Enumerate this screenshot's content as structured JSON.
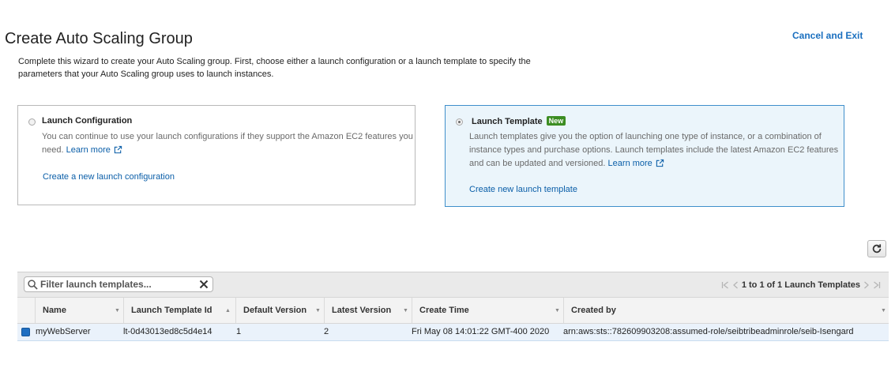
{
  "header": {
    "title": "Create Auto Scaling Group",
    "cancel_label": "Cancel and Exit"
  },
  "intro": {
    "text": "Complete this wizard to create your Auto Scaling group. First, choose either a launch configuration or a launch template to specify the parameters that your Auto Scaling group uses to launch instances."
  },
  "options": {
    "launch_configuration": {
      "title": "Launch Configuration",
      "description": "You can continue to use your launch configurations if they support the Amazon EC2 features you need.",
      "learn_more": "Learn more",
      "action": "Create a new launch configuration",
      "selected": false
    },
    "launch_template": {
      "title": "Launch Template",
      "badge": "New",
      "description": "Launch templates give you the option of launching one type of instance, or a combination of instance types and purchase options. Launch templates include the latest Amazon EC2 features and can be updated and versioned.",
      "learn_more": "Learn more",
      "action": "Create new launch template",
      "selected": true
    }
  },
  "table": {
    "filter_placeholder": "Filter launch templates...",
    "pagination": "1 to 1 of 1 Launch Templates",
    "columns": [
      "Name",
      "Launch Template Id",
      "Default Version",
      "Latest Version",
      "Create Time",
      "Created by"
    ],
    "rows": [
      {
        "name": "myWebServer",
        "id": "lt-0d43013ed8c5d4e14",
        "default_version": "1",
        "latest_version": "2",
        "create_time": "Fri May 08 14:01:22 GMT-400 2020",
        "created_by": "arn:aws:sts::782609903208:assumed-role/seibtribeadminrole/seib-Isengard",
        "selected": true
      }
    ]
  },
  "colors": {
    "link": "#0a5ea8",
    "selected_card_bg": "#ebf5fb",
    "selected_card_border": "#3f8fcb",
    "new_badge": "#3c8d22",
    "row_selected_bg": "#eaf2fb"
  },
  "icons": {
    "external_link": "external-link-icon",
    "search": "search-icon",
    "clear": "close-icon",
    "refresh": "refresh-icon"
  }
}
